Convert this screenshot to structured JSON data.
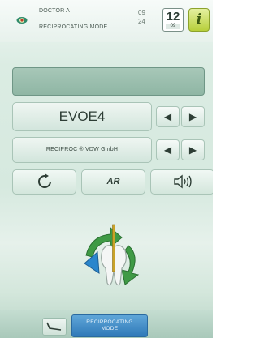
{
  "header": {
    "doctor": "DOCTOR A",
    "mode": "RECIPROCATING MODE",
    "time_hour": "09",
    "time_minute": "24",
    "date_day": "12",
    "date_month": "09",
    "info_label": "i"
  },
  "file": {
    "name": "EVOE4"
  },
  "system": {
    "name": "RECIPROC ® VDW GmbH"
  },
  "functions": {
    "rotation_label": "",
    "ar_label": "AR",
    "sound_label": ""
  },
  "footer": {
    "mode_line1": "RECIPROCATING",
    "mode_line2": "MODE"
  },
  "icons": {
    "logo": "eye-logo-icon",
    "rotation": "rotation-arrow-icon",
    "sound": "speaker-icon",
    "handpiece": "handpiece-icon",
    "motion": "tooth-reciprocating-icon",
    "arrow_left": "arrow-left-icon",
    "arrow_right": "arrow-right-icon"
  },
  "colors": {
    "accent_blue": "#2f79b8",
    "info_green": "#b7cf3a",
    "panel_border": "#a9c4b7"
  }
}
